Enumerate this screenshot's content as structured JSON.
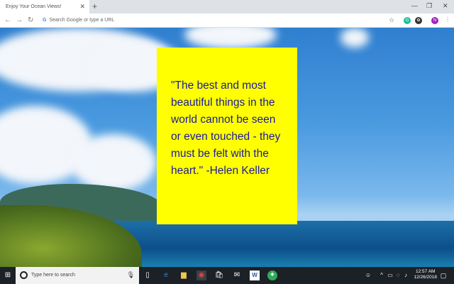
{
  "browser": {
    "tab_title": "Enjoy Your Ocean Views!",
    "omnibox_placeholder": "Search Google or type a URL",
    "profile_initial": "N"
  },
  "quote": {
    "text": "\"The best and most beautiful things in the world cannot be seen or even touched - they must be felt with the heart.\" -Helen Keller"
  },
  "taskbar": {
    "search_placeholder": "Type here to search",
    "time": "12:57 AM",
    "date": "12/26/2018"
  }
}
